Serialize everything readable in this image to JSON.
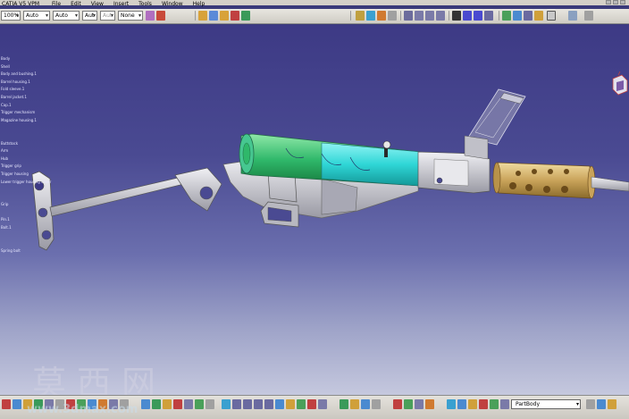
{
  "window": {
    "title": "CATIA V5 VPM"
  },
  "menu": [
    "CATIA V5 VPM",
    "File",
    "Edit",
    "View",
    "Insert",
    "Tools",
    "Window",
    "Help"
  ],
  "toolbar": {
    "zoom_value": "100%",
    "combo_1": "Auto",
    "combo_2": "Auto",
    "combo_3": "Aut",
    "combo_4": "Aut",
    "combo_5": "None"
  },
  "tree": {
    "nodes": [
      "Body",
      "Shell",
      "Body and bushing.1",
      "Barrel housing.1",
      "Fold sleeve.1",
      "Barrel jacket.1",
      "Cap.1",
      "Trigger mechanism",
      "Magazine housing.1",
      "",
      "",
      "Buttstock",
      "Arm",
      "Hub",
      "Trigger grip",
      "Trigger housing",
      "Lower trigger housing cover",
      "",
      "",
      "Grip",
      "",
      "Pin.1",
      "Bolt.1",
      "",
      "",
      "Spring bolt"
    ]
  },
  "status": {
    "part_selector": "PartBody"
  },
  "watermark": {
    "text": "莫西网",
    "url": "www.3dmax.com"
  },
  "colors": {
    "background_top": "#3d3a85",
    "background_bottom": "#c5c8de",
    "barrel_cyan": "#2fd6d6",
    "barrel_green": "#2fb86a",
    "muzzle_tan": "#c9a35a",
    "part_gray": "#c8c8cc"
  },
  "icons": [
    "catia-compass-icon",
    "undo-icon",
    "redo-icon",
    "fit-all-icon",
    "pan-icon",
    "rotate-icon",
    "zoom-in-icon",
    "zoom-out-icon",
    "normal-view-icon",
    "shading-icon",
    "hide-show-icon"
  ]
}
